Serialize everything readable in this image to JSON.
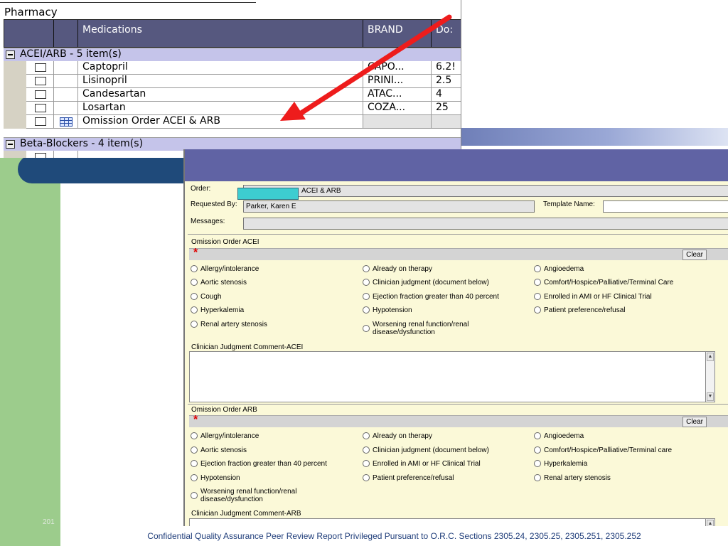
{
  "pharmacy": {
    "title": "Pharmacy",
    "columns": [
      "Medications",
      "BRAND",
      "Do:"
    ],
    "groups": [
      {
        "label": "ACEI/ARB - 5 item(s)",
        "items": [
          {
            "name": "Captopril",
            "brand": "CAPO...",
            "dose": "6.2!"
          },
          {
            "name": "Lisinopril",
            "brand": "PRINI...",
            "dose": "2.5"
          },
          {
            "name": "Candesartan",
            "brand": "ATAC...",
            "dose": "4"
          },
          {
            "name": "Losartan",
            "brand": "COZA...",
            "dose": "25"
          },
          {
            "name": "Omission Order ACEI & ARB",
            "brand": "",
            "dose": ""
          }
        ]
      },
      {
        "label": "Beta-Blockers - 4 item(s)",
        "items": []
      }
    ]
  },
  "order_form": {
    "order_label": "Order:",
    "order_value": "ACEI & ARB",
    "requested_by_label": "Requested By:",
    "requested_by_value": "Parker, Karen E",
    "template_name_label": "Template Name:",
    "template_name_value": "",
    "messages_label": "Messages:",
    "messages_value": "",
    "clear_label": "Clear",
    "acei": {
      "title": "Omission Order ACEI",
      "options": [
        "Allergy/intolerance",
        "Already on therapy",
        "Angioedema",
        "Aortic stenosis",
        "Clinician judgment (document below)",
        "Comfort/Hospice/Palliative/Terminal Care",
        "Cough",
        "Ejection fraction greater than 40 percent",
        "Enrolled in AMI or HF Clinical Trial",
        "Hyperkalemia",
        "Hypotension",
        "Patient preference/refusal",
        "Renal artery stenosis",
        "Worsening renal function/renal disease/dysfunction"
      ],
      "comment_label": "Clinician Judgment Comment-ACEI"
    },
    "arb": {
      "title": "Omission Order ARB",
      "options": [
        "Allergy/intolerance",
        "Already on therapy",
        "Angioedema",
        "Aortic stenosis",
        "Clinician judgment (document below)",
        "Comfort/Hospice/Palliative/Terminal care",
        "Ejection fraction greater than 40 percent",
        "Enrolled in AMI or HF Clinical Trial",
        "Hyperkalemia",
        "Hypotension",
        "Patient preference/refusal",
        "Renal artery stenosis",
        "Worsening renal function/renal disease/dysfunction"
      ],
      "comment_label": "Clinician Judgment Comment-ARB"
    }
  },
  "slide": {
    "number_text": "201",
    "footer": "Confidential Quality Assurance Peer Review Report Privileged Pursuant to O.R.C. Sections 2305.24, 2305.25, 2305.251, 2305.252"
  },
  "colors": {
    "arrow": "#ee1c1c",
    "form_header": "#6063a4",
    "grid_header": "#56587f",
    "group_row": "#c5c4ea",
    "slide_green": "#9ccc8c",
    "required_star": "#e00000"
  },
  "icons": {
    "order_sentence_icon": "grid-icon",
    "collapse_group_icon": "minus-icon",
    "arrow_annotation": "red-arrow"
  }
}
